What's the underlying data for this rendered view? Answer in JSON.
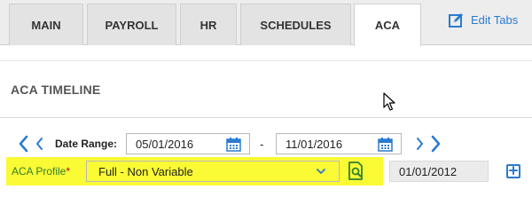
{
  "tabs": [
    {
      "label": "MAIN"
    },
    {
      "label": "PAYROLL"
    },
    {
      "label": "HR"
    },
    {
      "label": "SCHEDULES"
    },
    {
      "label": "ACA",
      "active": true
    }
  ],
  "edit_tabs": {
    "label": "Edit Tabs",
    "icon": "edit-icon"
  },
  "section": {
    "title": "ACA TIMELINE"
  },
  "date_range": {
    "label": "Date Range:",
    "start": "05/01/2016",
    "separator": "-",
    "end": "11/01/2016",
    "icon": "calendar-icon"
  },
  "aca_profile": {
    "label": "ACA Profile",
    "required_mark": "*",
    "selected": "Full - Non Variable",
    "effective_date": "01/01/2012",
    "highlight_color": "#fafa35"
  },
  "colors": {
    "accent": "#2a7bd0",
    "label_green": "#2f7f2f"
  }
}
